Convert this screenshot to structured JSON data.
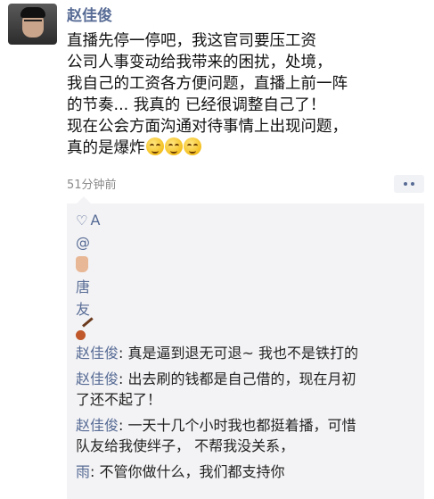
{
  "post": {
    "author": "赵佳俊",
    "lines": [
      "直播先停一停吧，我这官司要压工资",
      "公司人事变动给我带来的困扰，处境，",
      "我自己的工资各方便问题，直播上前一阵",
      "的节奏... 我真的 已经很调整自己了！",
      "现在公会方面沟通对待事情上出现问题，",
      "真的是爆炸"
    ],
    "emoji": "grinning-sweat-emoji x3",
    "time": "51分钟前"
  },
  "likes": {
    "rows": [
      "A",
      "@",
      "",
      "唐",
      "友",
      ""
    ]
  },
  "comments": [
    {
      "name": "赵佳俊",
      "sep": ": ",
      "lines": [
        "真是逼到退无可退~ 我也不是铁打的"
      ]
    },
    {
      "name": "赵佳俊",
      "sep": ": ",
      "lines": [
        "出去刷的钱都是自己借的，现在月初",
        "了还不起了！"
      ]
    },
    {
      "name": "赵佳俊",
      "sep": ": ",
      "lines": [
        "一天十几个小时我也都挺着播，可惜",
        "队友给我使绊子，  不帮我没关系，"
      ]
    },
    {
      "name": "雨",
      "sep": ": ",
      "lines": [
        "不管你做什么，我们都支持你"
      ]
    }
  ],
  "colors": {
    "link": "#576b95",
    "comment_bg": "#f3f3f5",
    "time": "#8a8a8a"
  }
}
